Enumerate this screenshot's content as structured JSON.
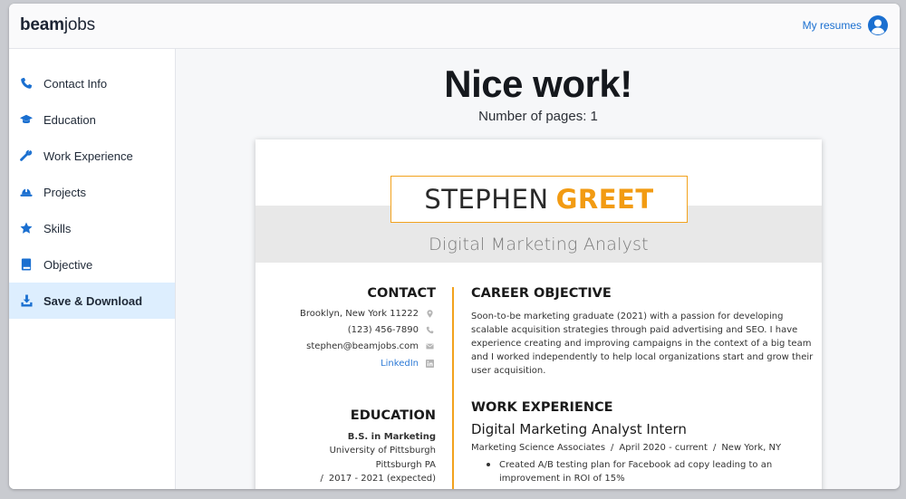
{
  "app": {
    "logo_bold": "beam",
    "logo_light": "jobs",
    "my_resumes": "My resumes"
  },
  "sidebar": {
    "items": [
      {
        "label": "Contact Info",
        "icon": "phone-icon"
      },
      {
        "label": "Education",
        "icon": "graduation-cap-icon"
      },
      {
        "label": "Work Experience",
        "icon": "wrench-icon"
      },
      {
        "label": "Projects",
        "icon": "hard-hat-icon"
      },
      {
        "label": "Skills",
        "icon": "star-icon"
      },
      {
        "label": "Objective",
        "icon": "book-icon"
      },
      {
        "label": "Save & Download",
        "icon": "download-icon",
        "active": true
      }
    ]
  },
  "main": {
    "headline": "Nice work!",
    "pages": "Number of pages: 1"
  },
  "resume": {
    "first_name": "STEPHEN",
    "last_name": "GREET",
    "subtitle": "Digital Marketing Analyst",
    "contact": {
      "heading": "CONTACT",
      "address": "Brooklyn, New York 11222",
      "phone": "(123) 456-7890",
      "email": "stephen@beamjobs.com",
      "linkedin": "LinkedIn"
    },
    "education": {
      "heading": "EDUCATION",
      "degree": "B.S. in Marketing",
      "school": "University of Pittsburgh",
      "city": "Pittsburgh PA",
      "slash": "/",
      "dates": "2017 - 2021 (expected)"
    },
    "objective": {
      "heading": "CAREER OBJECTIVE",
      "text": "Soon-to-be marketing graduate (2021) with a passion for developing scalable acquisition strategies through paid advertising and SEO. I have experience creating and improving campaigns in the context of a big team and I worked independently to help local organizations start and grow their user acquisition."
    },
    "work": {
      "heading": "WORK EXPERIENCE",
      "title": "Digital Marketing Analyst Intern",
      "company": "Marketing Science Associates",
      "dates": "April 2020 - current",
      "location": "New York, NY",
      "separator": "/",
      "bullets": [
        "Created A/B testing plan for Facebook ad copy leading to an improvement in ROI of 15%"
      ]
    }
  },
  "colors": {
    "accent": "#f29b12",
    "link": "#1a6fd0",
    "active_nav": "#ddeefe"
  }
}
